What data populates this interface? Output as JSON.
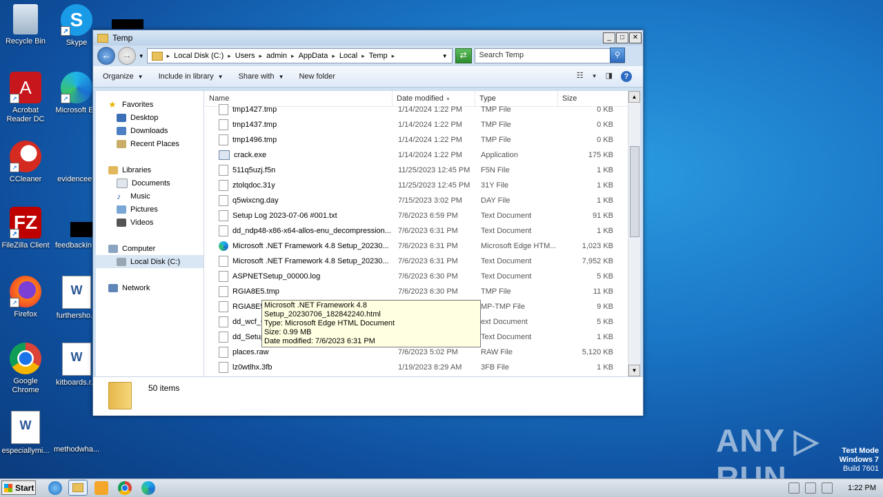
{
  "desktop": {
    "icons": [
      {
        "label": "Recycle Bin"
      },
      {
        "label": "Skype"
      },
      {
        "label": "Acrobat Reader DC"
      },
      {
        "label": "Microsoft Ed"
      },
      {
        "label": "CCleaner"
      },
      {
        "label": "evidenceev"
      },
      {
        "label": "FileZilla Client"
      },
      {
        "label": "feedbackin..."
      },
      {
        "label": "Firefox"
      },
      {
        "label": "furthersho..."
      },
      {
        "label": "Google Chrome"
      },
      {
        "label": "kitboards.r..."
      },
      {
        "label": "especiallymi..."
      },
      {
        "label": "methodwha..."
      }
    ]
  },
  "window": {
    "title": "Temp",
    "controls": {
      "minimize": "_",
      "maximize": "□",
      "close": "✕"
    },
    "address": {
      "crumbs": [
        "Local Disk (C:)",
        "Users",
        "admin",
        "AppData",
        "Local",
        "Temp"
      ],
      "search_placeholder": "Search Temp"
    },
    "toolbar": {
      "organize": "Organize",
      "include": "Include in library",
      "share": "Share with",
      "new_folder": "New folder"
    },
    "nav": {
      "favorites": "Favorites",
      "desktop": "Desktop",
      "downloads": "Downloads",
      "recent": "Recent Places",
      "libraries": "Libraries",
      "documents": "Documents",
      "music": "Music",
      "pictures": "Pictures",
      "videos": "Videos",
      "computer": "Computer",
      "local_disk": "Local Disk (C:)",
      "network": "Network"
    },
    "columns": {
      "name": "Name",
      "date": "Date modified",
      "type": "Type",
      "size": "Size"
    },
    "files": [
      {
        "name": "tmp1427.tmp",
        "date": "1/14/2024 1:22 PM",
        "type": "TMP File",
        "size": "0 KB",
        "icon": "file"
      },
      {
        "name": "tmp1437.tmp",
        "date": "1/14/2024 1:22 PM",
        "type": "TMP File",
        "size": "0 KB",
        "icon": "file"
      },
      {
        "name": "tmp1496.tmp",
        "date": "1/14/2024 1:22 PM",
        "type": "TMP File",
        "size": "0 KB",
        "icon": "file"
      },
      {
        "name": "crack.exe",
        "date": "1/14/2024 1:22 PM",
        "type": "Application",
        "size": "175 KB",
        "icon": "app"
      },
      {
        "name": "511q5uzj.f5n",
        "date": "11/25/2023 12:45 PM",
        "type": "F5N File",
        "size": "1 KB",
        "icon": "file"
      },
      {
        "name": "ztolqdoc.31y",
        "date": "11/25/2023 12:45 PM",
        "type": "31Y File",
        "size": "1 KB",
        "icon": "file"
      },
      {
        "name": "q5wixcng.day",
        "date": "7/15/2023 3:02 PM",
        "type": "DAY File",
        "size": "1 KB",
        "icon": "file"
      },
      {
        "name": "Setup Log 2023-07-06 #001.txt",
        "date": "7/6/2023 6:59 PM",
        "type": "Text Document",
        "size": "91 KB",
        "icon": "file"
      },
      {
        "name": "dd_ndp48-x86-x64-allos-enu_decompression...",
        "date": "7/6/2023 6:31 PM",
        "type": "Text Document",
        "size": "1 KB",
        "icon": "file"
      },
      {
        "name": "Microsoft .NET Framework 4.8 Setup_20230...",
        "date": "7/6/2023 6:31 PM",
        "type": "Microsoft Edge HTM...",
        "size": "1,023 KB",
        "icon": "edge"
      },
      {
        "name": "Microsoft .NET Framework 4.8 Setup_20230...",
        "date": "7/6/2023 6:31 PM",
        "type": "Text Document",
        "size": "7,952 KB",
        "icon": "file"
      },
      {
        "name": "ASPNETSetup_00000.log",
        "date": "7/6/2023 6:30 PM",
        "type": "Text Document",
        "size": "5 KB",
        "icon": "file"
      },
      {
        "name": "RGIA8E5.tmp",
        "date": "7/6/2023 6:30 PM",
        "type": "TMP File",
        "size": "11 KB",
        "icon": "file"
      },
      {
        "name": "RGIA8E5",
        "date": "",
        "type": "MP-TMP File",
        "size": "9 KB",
        "icon": "file"
      },
      {
        "name": "dd_wcf_C",
        "date": "",
        "type": "ext Document",
        "size": "5 KB",
        "icon": "file"
      },
      {
        "name": "dd_SetupUtility.txt",
        "date": "7/6/2023 6:29 PM",
        "type": "Text Document",
        "size": "1 KB",
        "icon": "file"
      },
      {
        "name": "places.raw",
        "date": "7/6/2023 5:02 PM",
        "type": "RAW File",
        "size": "5,120 KB",
        "icon": "file"
      },
      {
        "name": "lz0wtlhx.3fb",
        "date": "1/19/2023 8:29 AM",
        "type": "3FB File",
        "size": "1 KB",
        "icon": "file"
      }
    ],
    "tooltip": {
      "line1": "Microsoft .NET Framework 4.8 Setup_20230706_182842240.html",
      "line2": "Type: Microsoft Edge HTML Document",
      "line3": "Size: 0.99 MB",
      "line4": "Date modified: 7/6/2023 6:31 PM"
    },
    "status": {
      "count": "50 items"
    }
  },
  "taskbar": {
    "start": "Start",
    "clock": "1:22 PM"
  },
  "overlay": {
    "watermark": "ANY ▷ RUN",
    "test_mode": "Test Mode",
    "os": "Windows 7",
    "build": "Build 7601"
  },
  "colors": {
    "window_frame": "#cfe0f2",
    "selection": "#d9e6f4",
    "tooltip_bg": "#ffffe1"
  }
}
